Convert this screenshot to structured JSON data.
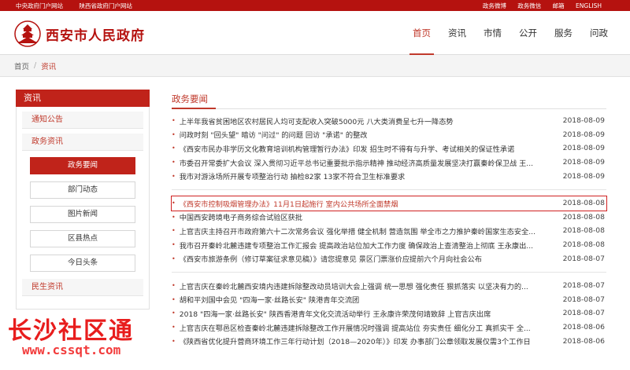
{
  "topbar": {
    "left": [
      "中央政府门户网站",
      "陕西省政府门户网站"
    ],
    "right": [
      "政务微博",
      "政务微信",
      "邮箱",
      "ENGLISH"
    ]
  },
  "header": {
    "logo_text": "西安市人民政府",
    "nav": [
      "首页",
      "资讯",
      "市情",
      "公开",
      "服务",
      "问政"
    ],
    "active_nav": "首页"
  },
  "breadcrumb": {
    "home": "首页",
    "sep": "/",
    "current": "资讯"
  },
  "sidebar": {
    "title": "资讯",
    "cat1": "通知公告",
    "cat2": "政务资讯",
    "sub_items": [
      "政务要闻",
      "部门动态",
      "图片新闻",
      "区县热点",
      "今日头条"
    ],
    "cat3": "民生资讯"
  },
  "main": {
    "title": "政务要闻",
    "group1": [
      {
        "text": "上半年我省贫困地区农村居民人均可支配收入突破5000元 八大类消费呈七升一降态势",
        "date": "2018-08-09"
      },
      {
        "text": "问政时刻 \"回头望\" 暗访 \"问过\" 的问题 回访 \"承诺\" 的整改",
        "date": "2018-08-09"
      },
      {
        "text": "《西安市民办非学历文化教育培训机构管理暂行办法》印发 招生时不得有与升学、考试相关的保证性承诺",
        "date": "2018-08-09"
      },
      {
        "text": "市委召开常委扩大会议 深入贯彻习近平总书记重要批示指示精神 推动经济高质量发展坚决打赢秦岭保卫战 王...",
        "date": "2018-08-09"
      },
      {
        "text": "我市对游泳场所开展专项整治行动 抽检82家 13家不符合卫生标准要求",
        "date": "2018-08-09"
      }
    ],
    "group2": [
      {
        "text": "《西安市控制吸烟管理办法》11月1日起施行 室内公共场所全面禁烟",
        "date": "2018-08-08"
      },
      {
        "text": "中国西安跨境电子商务综合试验区获批",
        "date": "2018-08-08"
      },
      {
        "text": "上官吉庆主持召开市政府第六十二次常务会议 强化举措 健全机制 营造氛围 举全市之力推护秦岭国家生态安全...",
        "date": "2018-08-08"
      },
      {
        "text": "我市召开秦岭北麓违建专项整治工作汇报会 提高政治站位加大工作力度 确保政治上查清整治上彻底 王永康出...",
        "date": "2018-08-08"
      },
      {
        "text": "《西安市旅游条例（修订草案征求意见稿）》请您提意见 景区门票涨价应提前六个月向社会公布",
        "date": "2018-08-07"
      }
    ],
    "group3": [
      {
        "text": "上官吉庆在秦岭北麓西安境内违建拆除整改动员培训大会上强调 统一思想 强化责任 狠抓落实 以坚决有力的...",
        "date": "2018-08-07"
      },
      {
        "text": "胡和平刘国中会见 \"四海一家·丝路长安\" 陕港青年交流团",
        "date": "2018-08-07"
      },
      {
        "text": "2018 \"四海一家·丝路长安\" 陕西香港青年文化交流活动举行 王永康许荣茂何靖致辞 上官吉庆出席",
        "date": "2018-08-07"
      },
      {
        "text": "上官吉庆在鄠邑区检查秦岭北麓违建拆除整改工作开展情况时强调 提高站位 夯实责任 细化分工 真抓实干 全...",
        "date": "2018-08-06"
      },
      {
        "text": "《陕西省优化提升营商环境工作三年行动计划（2018—2020年）》印发 办事部门公章领取发展仅需3个工作日",
        "date": "2018-08-06"
      }
    ]
  },
  "watermark": {
    "cn": "长沙社区通",
    "url": "www.cssqt.com"
  },
  "colors": {
    "brand_red": "#c0231a",
    "accent_red": "#c0392b"
  }
}
